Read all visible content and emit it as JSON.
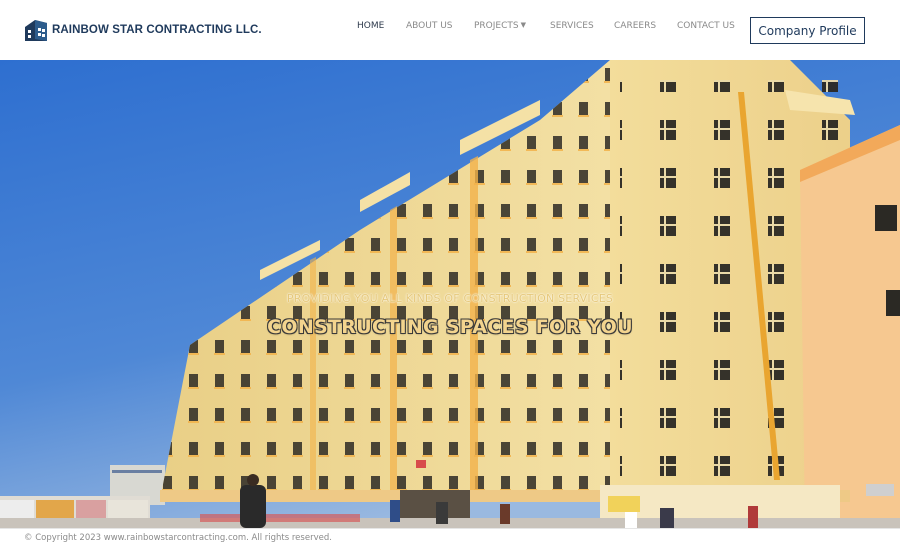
{
  "header": {
    "brand_name": "RAINBOW STAR CONTRACTING LLC.",
    "logo_icon": "building-logo-icon",
    "nav": [
      {
        "label": "HOME",
        "active": true
      },
      {
        "label": "ABOUT US",
        "active": false
      },
      {
        "label": "PROJECTS",
        "active": false,
        "dropdown": true
      },
      {
        "label": "SERVICES",
        "active": false
      },
      {
        "label": "CAREERS",
        "active": false
      },
      {
        "label": "CONTACT US",
        "active": false
      }
    ],
    "cta_label": "Company Profile"
  },
  "hero": {
    "subtitle": "PROVIDING YOU ALL KINDS OF CONSTRUCTION SERVICES",
    "title": "CONSTRUCTING SPACES FOR YOU"
  },
  "footer": {
    "copyright": "© Copyright 2023 www.rainbowstarcontracting.com. All rights reserved."
  },
  "colors": {
    "brand": "#1f3a5c",
    "nav_text": "#8a8a8a",
    "nav_active": "#2e3a4c",
    "sky": "#3b78c9",
    "building": "#f0dc9a",
    "accent_orange": "#f2b24a"
  }
}
